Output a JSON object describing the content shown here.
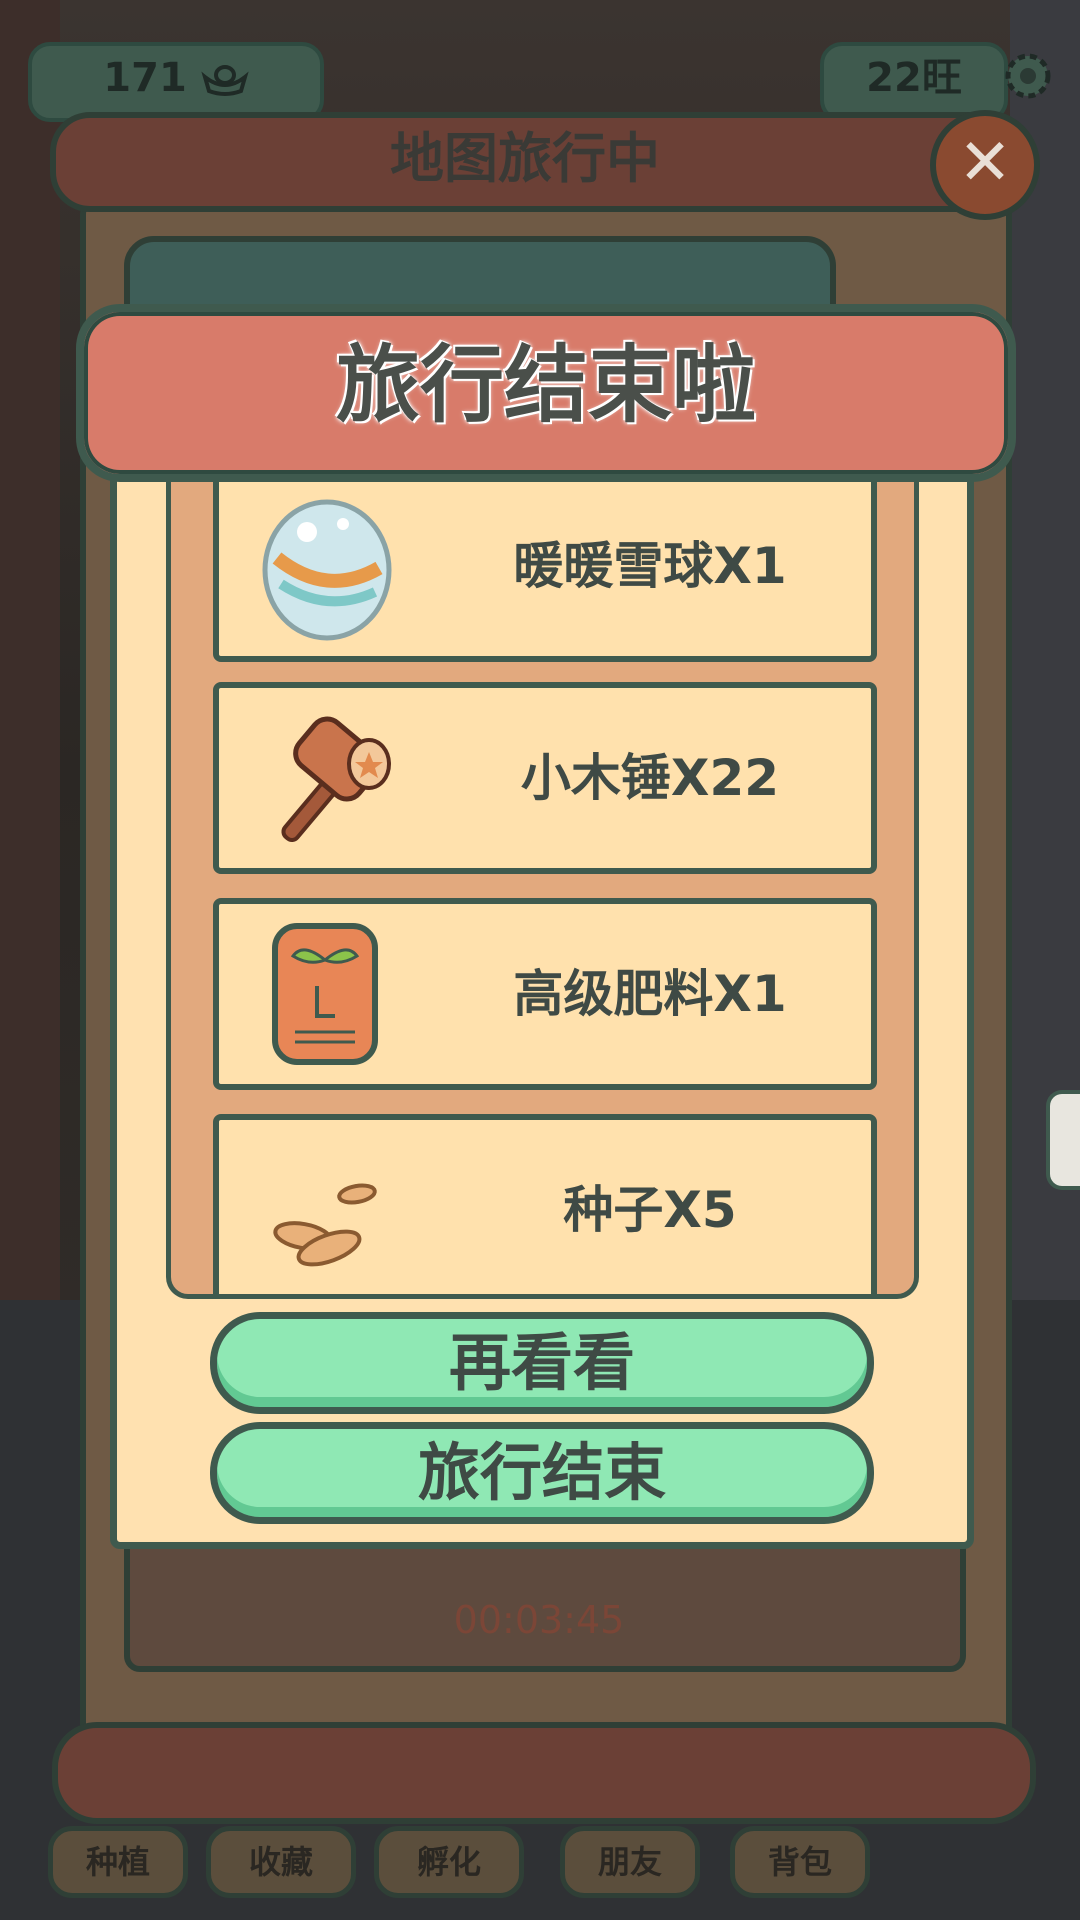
{
  "hud": {
    "coins": "171",
    "coin_icon": "ingot-icon",
    "wang": "22旺",
    "settings_icon": "gear-icon"
  },
  "travel_panel": {
    "title": "地图旅行中",
    "close_icon": "close-icon",
    "timer": "00:03:45"
  },
  "result_modal": {
    "title": "旅行结束啦",
    "items": [
      {
        "label": "暖暖雪球X1",
        "icon": "snowball-egg-icon"
      },
      {
        "label": "小木锤X22",
        "icon": "wooden-hammer-icon"
      },
      {
        "label": "高级肥料X1",
        "icon": "fertilizer-bag-icon"
      },
      {
        "label": "种子X5",
        "icon": "seeds-icon"
      }
    ],
    "buttons": {
      "again": "再看看",
      "end": "旅行结束"
    }
  },
  "bottom_nav": [
    "种植",
    "收藏",
    "孵化",
    "朋友",
    "背包"
  ],
  "colors": {
    "header": "#d87b6a",
    "panel": "#ffe1b0",
    "border": "#3f5a4e",
    "button": "#8fe8b4",
    "tray": "#e2a97e"
  }
}
